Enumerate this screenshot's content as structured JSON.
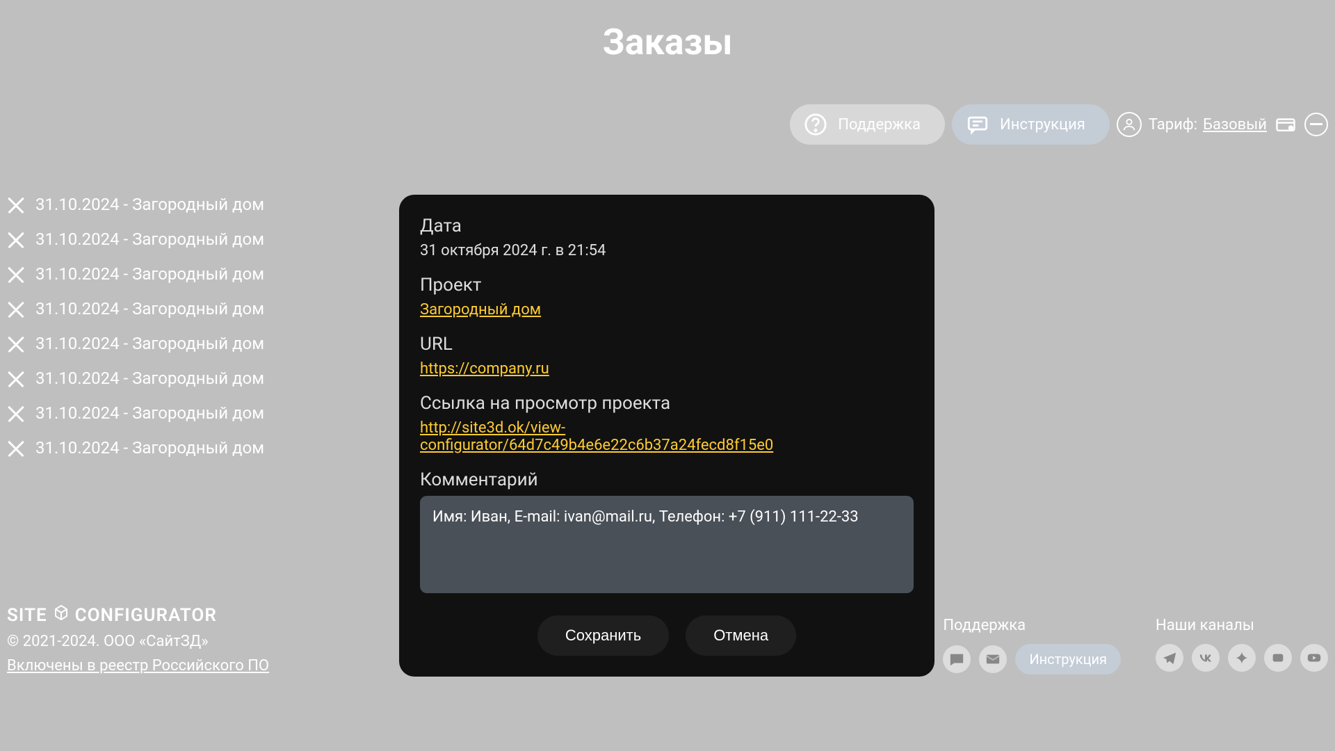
{
  "page": {
    "title": "Заказы"
  },
  "header": {
    "support_label": "Поддержка",
    "instruction_label": "Инструкция",
    "tariff_prefix": "Тариф:",
    "tariff_name": "Базовый"
  },
  "orders": [
    {
      "text": "31.10.2024 - Загородный дом"
    },
    {
      "text": "31.10.2024 - Загородный дом"
    },
    {
      "text": "31.10.2024 - Загородный дом"
    },
    {
      "text": "31.10.2024 - Загородный дом"
    },
    {
      "text": "31.10.2024 - Загородный дом"
    },
    {
      "text": "31.10.2024 - Загородный дом"
    },
    {
      "text": "31.10.2024 - Загородный дом"
    },
    {
      "text": "31.10.2024 - Загородный дом"
    }
  ],
  "detail": {
    "date_label": "Дата",
    "date_value": "31 октября 2024 г. в 21:54",
    "project_label": "Проект",
    "project_value": "Загородный дом",
    "url_label": "URL",
    "url_value": "https://company.ru",
    "view_label": "Ссылка на просмотр проекта",
    "view_value": "http://site3d.ok/view-configurator/64d7c49b4e6e22c6b37a24fecd8f15e0",
    "comment_label": "Комментарий",
    "comment_value": "Имя: Иван, E-mail: ivan@mail.ru, Телефон: +7 (911) 111-22-33",
    "save_label": "Сохранить",
    "cancel_label": "Отмена"
  },
  "footer": {
    "logo_left": "SITE",
    "logo_right": "CONFIGURATOR",
    "copyright": "© 2021-2024. ООО «СайтЗД»",
    "registry": "Включены в реестр Российского ПО",
    "support_heading": "Поддержка",
    "instruction_label": "Инструкция",
    "channels_heading": "Наши каналы"
  }
}
